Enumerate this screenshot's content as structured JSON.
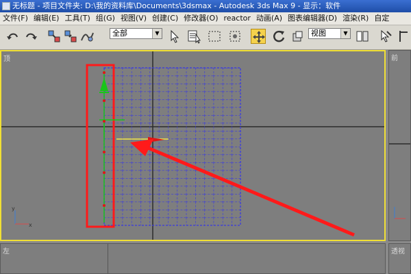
{
  "window": {
    "title": "无标题 - 项目文件夹: D:\\我的资料库\\Documents\\3dsmax - Autodesk 3ds Max 9 - 显示：软件"
  },
  "menu": {
    "items": [
      "文件(F)",
      "编辑(E)",
      "工具(T)",
      "组(G)",
      "视图(V)",
      "创建(C)",
      "修改器(O)",
      "reactor",
      "动画(A)",
      "图表编辑器(D)",
      "渲染(R)",
      "自定"
    ]
  },
  "toolbar": {
    "selection_filter": "全部",
    "reference_coord": "视图",
    "icons": [
      "undo-icon",
      "redo-icon",
      "select-link-icon",
      "unlink-icon",
      "bind-space-warp-icon",
      "select-object-icon",
      "select-by-name-icon",
      "rectangular-region-icon",
      "window-crossing-icon",
      "select-move-icon",
      "select-rotate-icon",
      "select-scale-icon",
      "pivot-center-icon",
      "select-manipulate-icon"
    ]
  },
  "viewports": {
    "top": "顶",
    "front": "前",
    "left": "左",
    "perspective": "透视"
  },
  "colors": {
    "active_viewport_border": "#f1e034",
    "grid_dots": "#3a3adf",
    "highlight_red": "#ff1a1a",
    "gizmo_green": "#19c519",
    "gizmo_red": "#e01515"
  }
}
